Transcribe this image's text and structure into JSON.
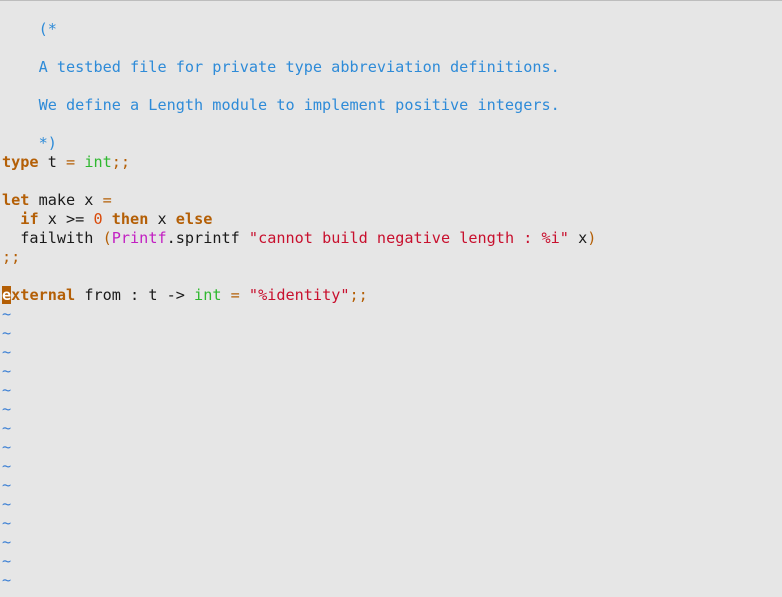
{
  "editor": {
    "comment_open": "(*",
    "comment_line1": "A testbed file for private type abbreviation definitions.",
    "comment_line2": "We define a Length module to implement positive integers.",
    "comment_close": "*)",
    "type_kw": "type",
    "type_name": " t ",
    "type_eq": "=",
    "type_int": " int",
    "type_semis": ";;",
    "let_kw": "let",
    "let_rest": " make x ",
    "let_eq": "=",
    "if_indent": "  ",
    "if_kw": "if",
    "if_cond": " x >= ",
    "if_zero": "0",
    "then_kw": " then",
    "then_rest": " x ",
    "else_kw": "else",
    "fail_ident": "  failwith ",
    "fail_paren_open": "(",
    "printf_module": "Printf",
    "sprintf_rest": ".sprintf ",
    "error_string": "\"cannot build negative length : %i\"",
    "fail_x": " x",
    "fail_paren_close": ")",
    "end_semis": ";;",
    "cursor_char": "e",
    "external_rest": "xternal",
    "external_sig": " from : t -> ",
    "external_int": "int",
    "external_eq": " = ",
    "identity_string": "\"%identity\"",
    "external_semis": ";;",
    "tilde": "~"
  }
}
